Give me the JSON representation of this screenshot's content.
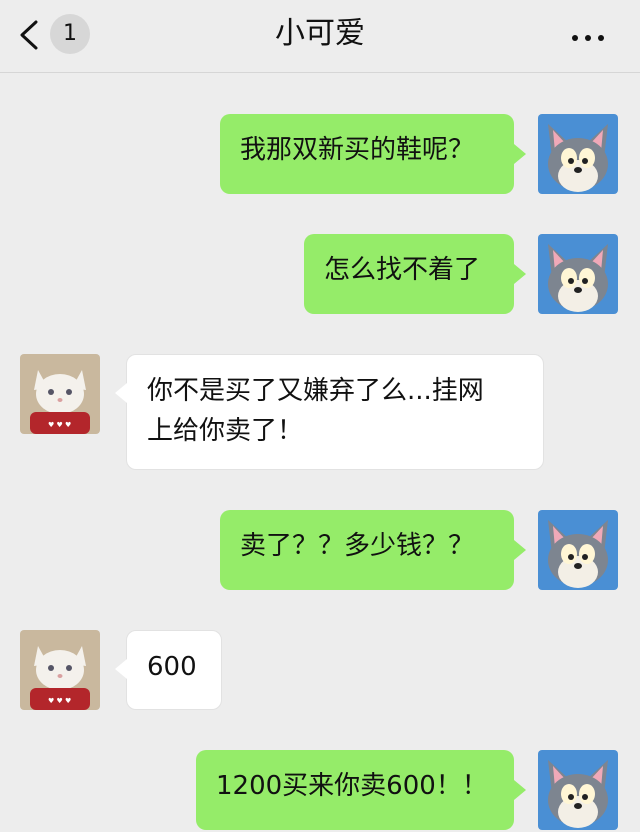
{
  "header": {
    "title": "小可爱",
    "unread_count": "1",
    "back_icon": "chevron-left-icon",
    "more_icon": "ellipsis-icon"
  },
  "colors": {
    "background": "#ededed",
    "sent_bubble": "#95ec69",
    "received_bubble": "#ffffff"
  },
  "messages": [
    {
      "from": "me",
      "text": "我那双新买的鞋呢？"
    },
    {
      "from": "me",
      "text": "怎么找不着了"
    },
    {
      "from": "them",
      "text": "你不是买了又嫌弃了么...挂网\n上给你卖了！"
    },
    {
      "from": "me",
      "text": "卖了？？多少钱？？"
    },
    {
      "from": "them",
      "text": "600"
    },
    {
      "from": "me",
      "text": "1200买来你卖600！！"
    }
  ]
}
